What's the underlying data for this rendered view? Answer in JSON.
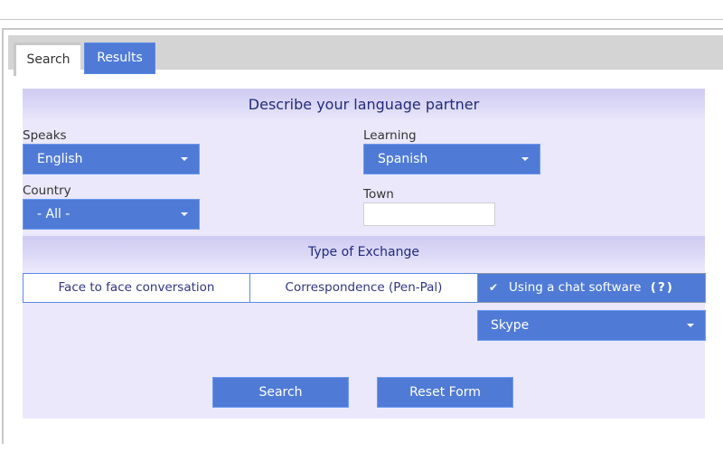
{
  "tabs": [
    {
      "label": "Search",
      "active": true
    },
    {
      "label": "Results",
      "active": false
    }
  ],
  "form": {
    "title": "Describe your language partner",
    "speaks": {
      "label": "Speaks",
      "value": "English"
    },
    "learning": {
      "label": "Learning",
      "value": "Spanish"
    },
    "country": {
      "label": "Country",
      "value": "- All -"
    },
    "town": {
      "label": "Town",
      "value": "",
      "placeholder": ""
    },
    "exchange": {
      "title": "Type of Exchange",
      "options": [
        {
          "label": "Face to face conversation",
          "selected": false
        },
        {
          "label": "Correspondence (Pen-Pal)",
          "selected": false
        },
        {
          "label": "Using a chat software",
          "selected": true,
          "help": "(?)",
          "check": "✔"
        }
      ],
      "chat_software": {
        "value": "Skype"
      }
    },
    "buttons": {
      "search": "Search",
      "reset": "Reset Form"
    }
  },
  "colors": {
    "accent": "#4f7bd6",
    "panel_bg": "#ebe8fb",
    "header_text": "#232a7c",
    "tab_strip": "#d4d4d4"
  }
}
